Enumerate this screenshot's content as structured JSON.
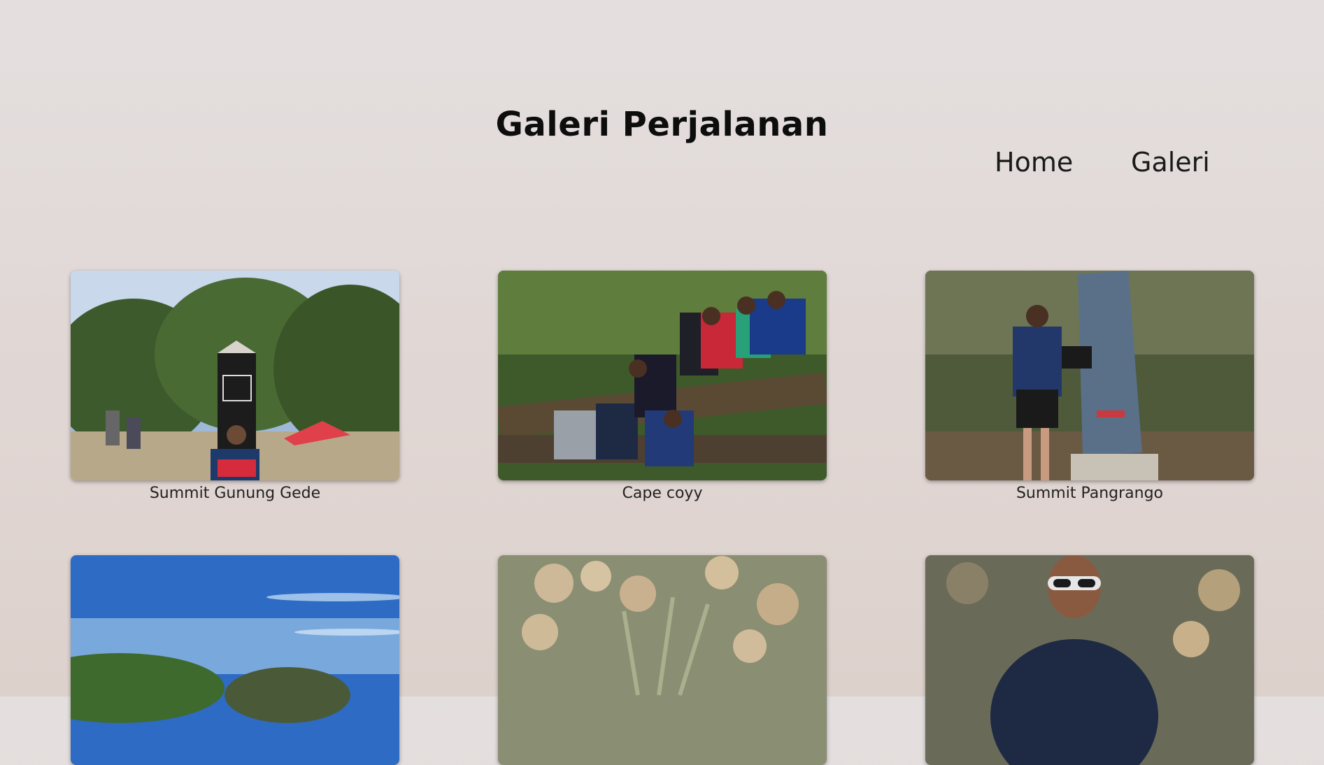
{
  "header": {
    "title": "Galeri Perjalanan"
  },
  "nav": {
    "items": [
      {
        "label": "Home"
      },
      {
        "label": "Galeri"
      }
    ]
  },
  "gallery": {
    "items": [
      {
        "caption": "Summit Gunung Gede",
        "image": "summit-gede-photo"
      },
      {
        "caption": "Cape coyy",
        "image": "group-resting-photo"
      },
      {
        "caption": "Summit Pangrango",
        "image": "summit-pangrango-photo"
      },
      {
        "caption": "",
        "image": "blue-sky-landscape-photo"
      },
      {
        "caption": "",
        "image": "edelweiss-flowers-photo"
      },
      {
        "caption": "",
        "image": "hiker-portrait-photo"
      }
    ]
  }
}
